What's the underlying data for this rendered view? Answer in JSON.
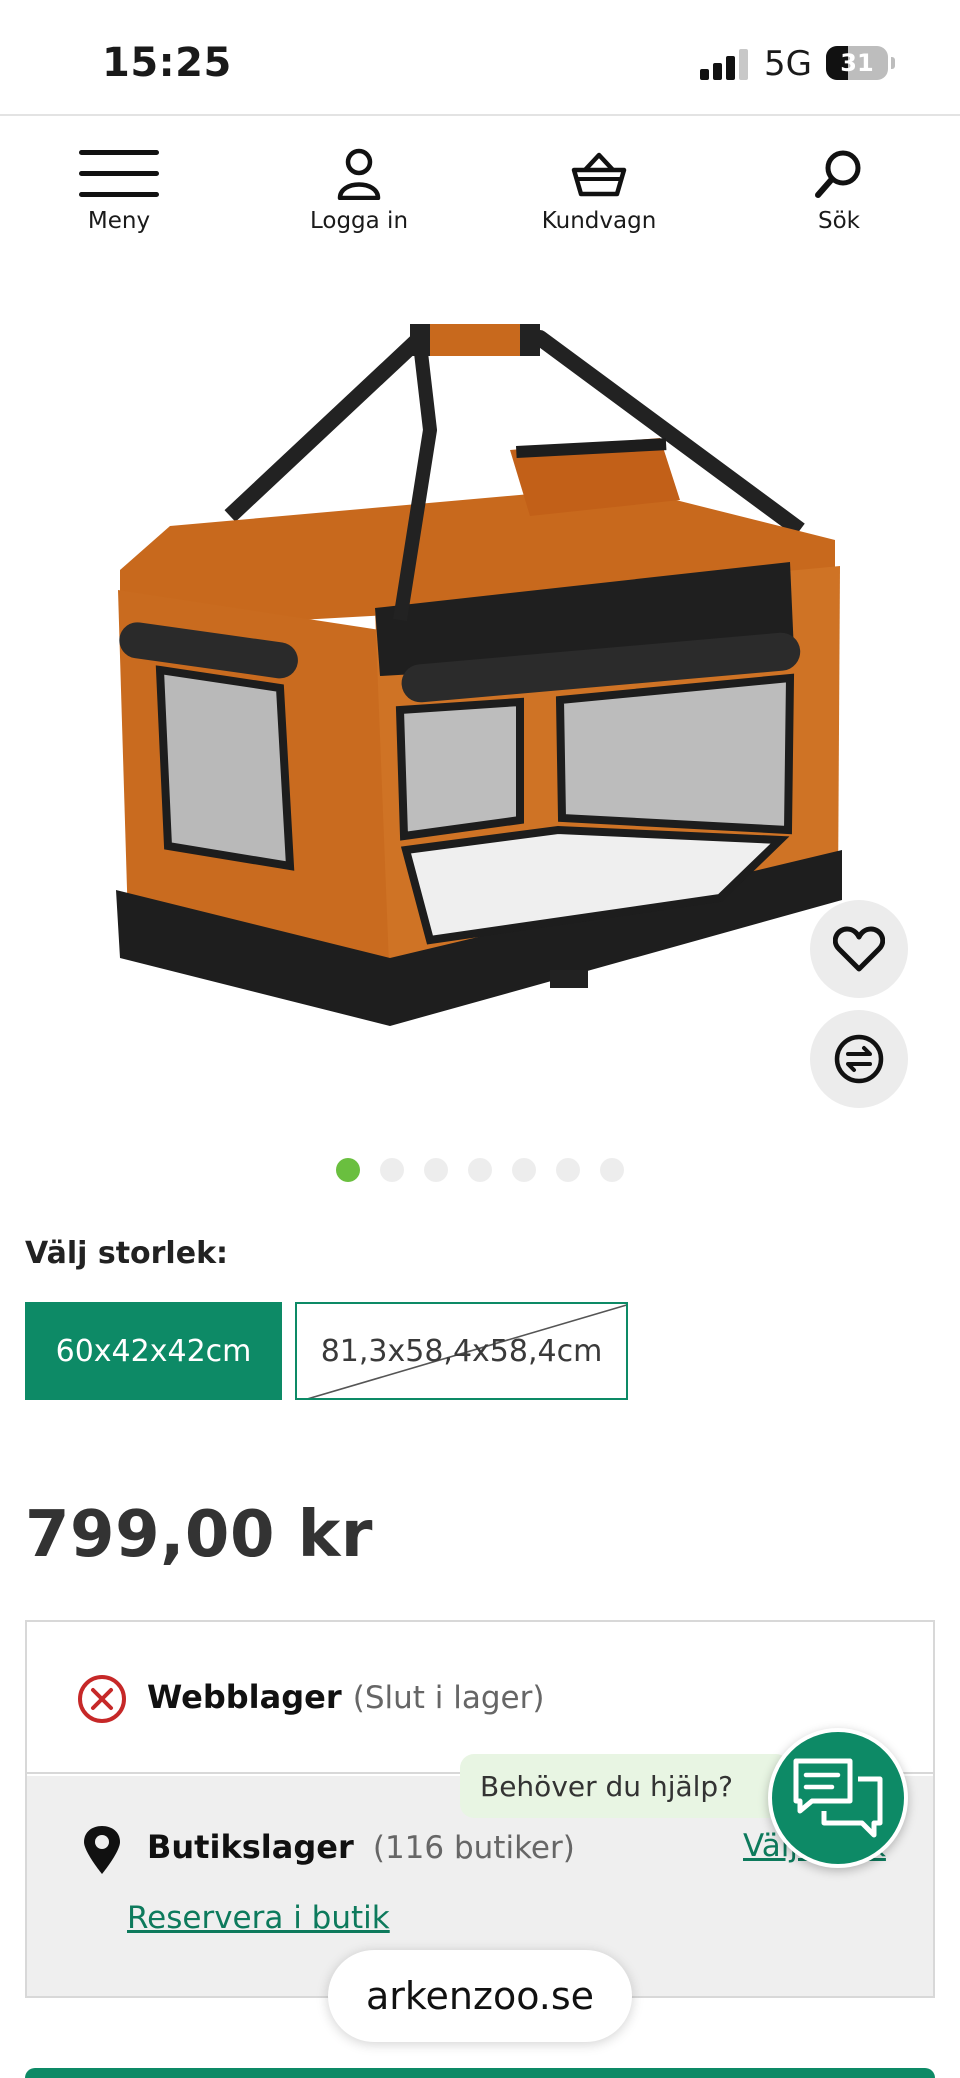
{
  "status_bar": {
    "time": "15:25",
    "network": "5G",
    "battery": "31",
    "battery_level": 0.31
  },
  "nav": {
    "menu": {
      "label": "Meny",
      "icon": "hamburger-icon"
    },
    "login": {
      "label": "Logga in",
      "icon": "user-icon"
    },
    "cart": {
      "label": "Kundvagn",
      "icon": "basket-icon"
    },
    "search": {
      "label": "Sök",
      "icon": "search-icon"
    }
  },
  "product": {
    "image_icon": "pet-carrier-image",
    "favorite_icon": "heart-icon",
    "compare_icon": "compare-icon",
    "carousel": {
      "count": 7,
      "active": 1
    }
  },
  "size": {
    "label": "Välj storlek:",
    "options": [
      {
        "label": "60x42x42cm",
        "state": "selected"
      },
      {
        "label": "81,3x58,4x58,4cm",
        "state": "unavailable"
      }
    ]
  },
  "price": "799,00 kr",
  "stock": {
    "web": {
      "title": "Webblager",
      "status": "(Slut i lager)",
      "icon": "x-circle-icon"
    },
    "store": {
      "title": "Butikslager",
      "count": "(116 butiker)",
      "icon": "map-pin-icon",
      "choose_link": "Välj butik",
      "reserve_link": "Reservera i butik"
    }
  },
  "help": {
    "bubble": "Behöver du hjälp?",
    "icon": "chat-icon"
  },
  "browser": {
    "domain": "arkenzoo.se"
  },
  "colors": {
    "accent": "#0d8a66",
    "dot_active": "#6abf3f",
    "error": "#c62828",
    "help_bg": "#e8f5e3"
  }
}
